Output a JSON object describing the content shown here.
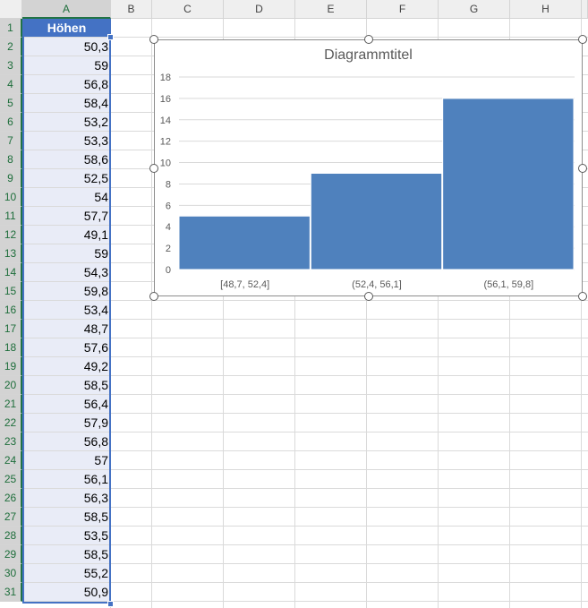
{
  "sheet": {
    "columns": [
      "A",
      "B",
      "C",
      "D",
      "E",
      "F",
      "G",
      "H"
    ],
    "rows": [
      "1",
      "2",
      "3",
      "4",
      "5",
      "6",
      "7",
      "8",
      "9",
      "10",
      "11",
      "12",
      "13",
      "14",
      "15",
      "16",
      "17",
      "18",
      "19",
      "20",
      "21",
      "22",
      "23",
      "24",
      "25",
      "26",
      "27",
      "28",
      "29",
      "30",
      "31"
    ],
    "header_cell": "Höhen",
    "values": [
      "50,3",
      "59",
      "56,8",
      "58,4",
      "53,2",
      "53,3",
      "58,6",
      "52,5",
      "54",
      "57,7",
      "49,1",
      "59",
      "54,3",
      "59,8",
      "53,4",
      "48,7",
      "57,6",
      "49,2",
      "58,5",
      "56,4",
      "57,9",
      "56,8",
      "57",
      "56,1",
      "56,3",
      "58,5",
      "53,5",
      "58,5",
      "55,2",
      "50,9"
    ]
  },
  "chart_data": {
    "type": "bar",
    "title": "Diagrammtitel",
    "categories": [
      "[48,7, 52,4]",
      "(52,4, 56,1]",
      "(56,1, 59,8]"
    ],
    "values": [
      5,
      9,
      16
    ],
    "ylim": [
      0,
      18
    ],
    "yticks": [
      "0",
      "2",
      "4",
      "6",
      "8",
      "10",
      "12",
      "14",
      "16",
      "18"
    ],
    "grid": true,
    "color": "#4f81bd"
  },
  "colors": {
    "accent": "#4472c4",
    "selection_fill": "#e9ecf7"
  }
}
